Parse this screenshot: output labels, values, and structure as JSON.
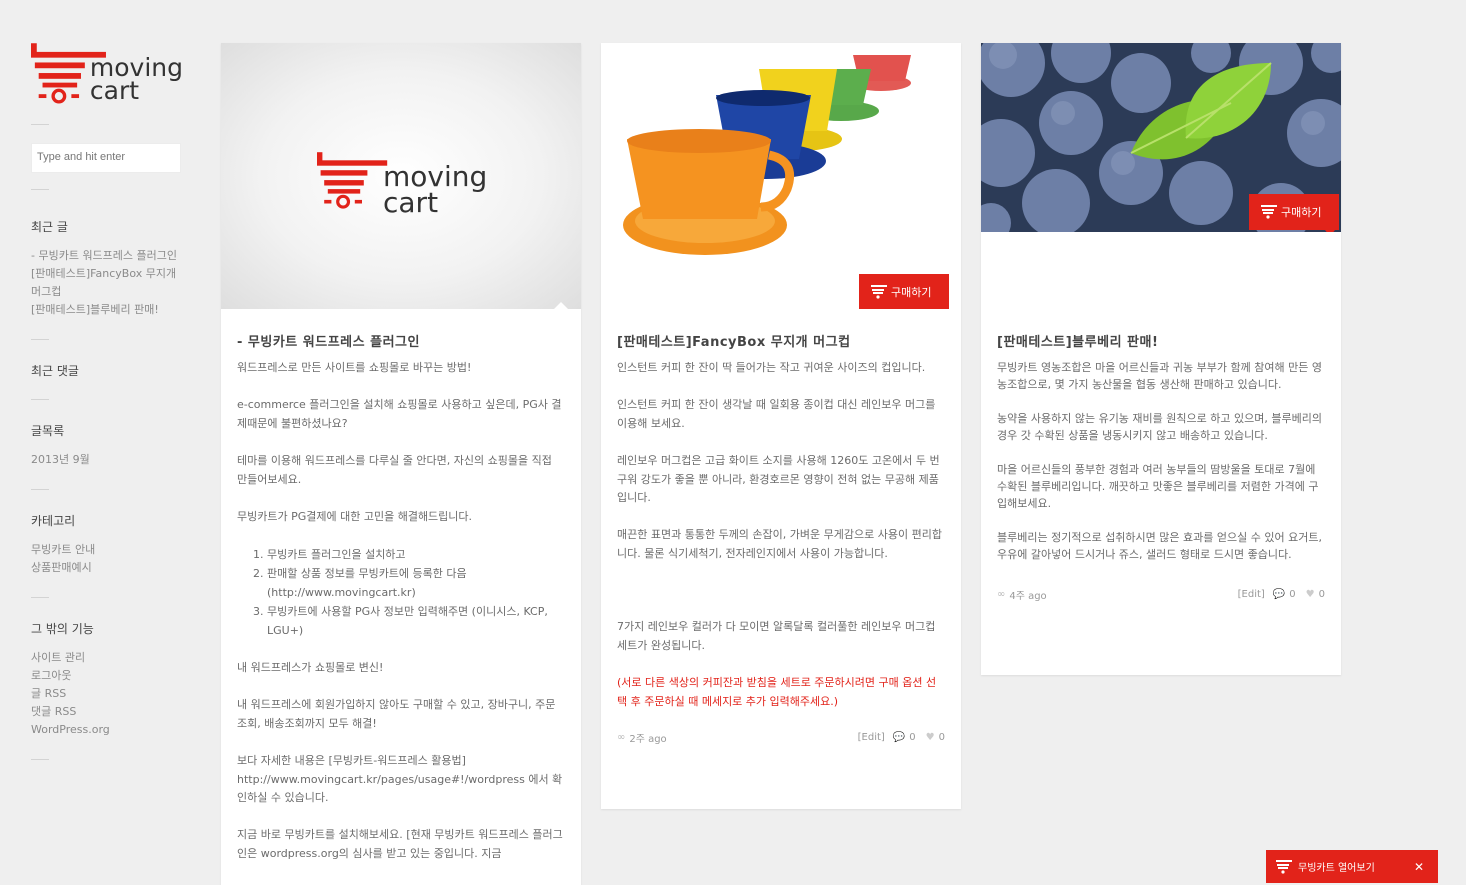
{
  "brand": {
    "line1": "moving",
    "line2": "cart",
    "color": "#e2231a"
  },
  "search": {
    "placeholder": "Type and hit enter"
  },
  "sidebar": {
    "recent_posts_title": "최근 글",
    "recent_posts": [
      "- 무빙카트 워드프레스 플러그인",
      "[판매테스트]FancyBox 무지개 머그컵",
      "[판매테스트]블루베리 판매!"
    ],
    "recent_comments_title": "최근 댓글",
    "archives_title": "글목록",
    "archives": [
      "2013년 9월"
    ],
    "categories_title": "카테고리",
    "categories": [
      "무빙카트 안내",
      "상품판매예시"
    ],
    "meta_title": "그 밖의 기능",
    "meta_links": [
      "사이트 관리",
      "로그아웃",
      "글 RSS",
      "댓글 RSS",
      "WordPress.org"
    ]
  },
  "buy_label": "구매하기",
  "posts": [
    {
      "title": "- 무빙카트 워드프레스 플러그인",
      "paragraphs": [
        "워드프레스로 만든 사이트를 쇼핑몰로 바꾸는 방법!",
        "e-commerce 플러그인을 설치해 쇼핑몰로 사용하고 싶은데, PG사 결제때문에 불편하셨나요?",
        "테마를 이용해 워드프레스를 다루실 줄 안다면, 자신의 쇼핑몰을 직접 만들어보세요.",
        "무빙카트가 PG결제에 대한 고민을 해결해드립니다."
      ],
      "list": [
        "무빙카트 플러그인을 설치하고",
        "판매할 상품 정보를 무빙카트에 등록한 다음 (http://www.movingcart.kr)",
        "무빙카트에 사용할 PG사 정보만 입력해주면 (이니시스, KCP, LGU+)"
      ],
      "paragraphs2": [
        "내 워드프레스가 쇼핑몰로 변신!",
        "내 워드프레스에 회원가입하지 않아도 구매할 수 있고, 장바구니, 주문조회, 배송조회까지 모두 해결!",
        "보다 자세한 내용은 [무빙카트-워드프레스 활용법] http://www.movingcart.kr/pages/usage#!/wordpress 에서 확인하실 수 있습니다.",
        "지금 바로 무빙카트를 설치해보세요. [현재 무빙카트 워드프레스 플러그인은 wordpress.org의 심사를 받고 있는 중입니다. 지금"
      ]
    },
    {
      "title": "[판매테스트]FancyBox 무지개 머그컵",
      "paragraphs": [
        "인스턴트 커피 한 잔이 딱 들어가는 작고 귀여운 사이즈의 컵입니다.",
        "인스턴트 커피 한 잔이 생각날 때 일회용 종이컵 대신 레인보우 머그를 이용해 보세요.",
        "레인보우 머그컵은 고급 화이트 소지를 사용해 1260도 고온에서 두 번 구워 강도가 좋을 뿐 아니라, 환경호르몬 영향이 전혀 없는 무공해 제품입니다.",
        "매끈한 표면과 통통한 두께의 손잡이, 가벼운 무게감으로 사용이 편리합니다. 물론 식기세척기, 전자레인지에서 사용이 가능합니다.",
        "7가지 레인보우 컬러가 다 모이면 알록달록 컬러풀한 레인보우 머그컵 세트가 완성됩니다."
      ],
      "notice": "(서로 다른 색상의 커피잔과 받침을 세트로 주문하시려면 구매 옵션 선택 후 주문하실 때 메세지로 추가 입력해주세요.)",
      "time": "2주 ago",
      "edit": "[Edit]",
      "comments": "0",
      "likes": "0"
    },
    {
      "title": "[판매테스트]블루베리 판매!",
      "paragraphs": [
        "무빙카트 영농조합은 마을 어르신들과 귀농 부부가 함께 참여해 만든 영농조합으로, 몇 가지 농산물을 협동 생산해 판매하고 있습니다.",
        "농약을 사용하지 않는 유기농 재비를 원칙으로 하고 있으며, 블루베리의 경우 갓 수확된 상품을 냉동시키지 않고 배송하고 있습니다.",
        "마을 어르신들의 풍부한 경험과 여러 농부들의 땀방울을 토대로 7월에 수확된 블루베리입니다. 깨끗하고 맛좋은 블루베리를 저렴한 가격에 구입해보세요.",
        "블루베리는 정기적으로 섭취하시면 많은 효과를 얻으실 수 있어 요거트, 우유에 갈아넣어 드시거나 쥬스, 샐러드 형태로 드시면 좋습니다."
      ],
      "time": "4주 ago",
      "edit": "[Edit]",
      "comments": "0",
      "likes": "0"
    }
  ],
  "footer_bar": {
    "label": "무빙카트 열어보기",
    "close": "✕"
  }
}
